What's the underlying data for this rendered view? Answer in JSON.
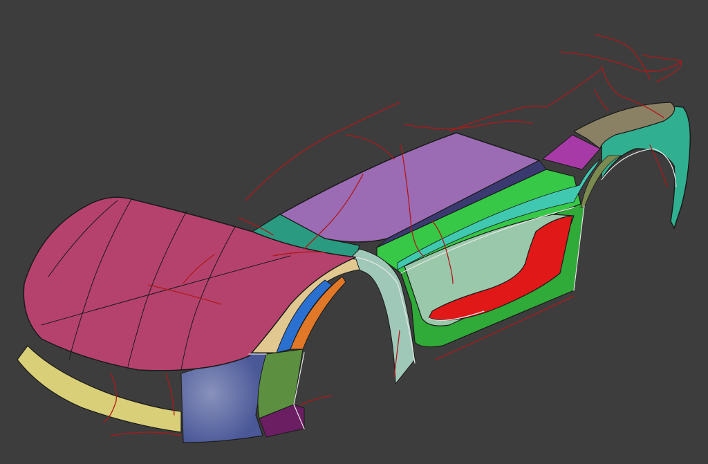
{
  "scene": {
    "background": "#3d3d3d",
    "edge_color": "#1a1a1a",
    "seam_color": "#e8e8e8",
    "curve_color": "#b01818",
    "surfaces": [
      {
        "name": "hood-surface",
        "color": "#b5426d"
      },
      {
        "name": "front-splitter",
        "color": "#d8cf78"
      },
      {
        "name": "front-bumper-corner",
        "color": "#4a5898"
      },
      {
        "name": "fender-inner-green",
        "color": "#5c9040"
      },
      {
        "name": "fender-purple-patch",
        "color": "#6c1e62"
      },
      {
        "name": "windshield-teal",
        "color": "#2a9a80"
      },
      {
        "name": "roof-lavender",
        "color": "#9b6bb3"
      },
      {
        "name": "roof-rail-navy",
        "color": "#3a3a70"
      },
      {
        "name": "side-green",
        "color": "#36c846"
      },
      {
        "name": "door-lower-green",
        "color": "#30aa38"
      },
      {
        "name": "side-intake-red",
        "color": "#e01818"
      },
      {
        "name": "side-panel-sage",
        "color": "#9ac8aa"
      },
      {
        "name": "rear-deck-khaki",
        "color": "#8a8064"
      },
      {
        "name": "rear-magenta",
        "color": "#a83aa8"
      },
      {
        "name": "rear-fender-teal",
        "color": "#30b090"
      },
      {
        "name": "front-arch-tan",
        "color": "#e0c890"
      },
      {
        "name": "front-arch-blue",
        "color": "#2a70d0"
      },
      {
        "name": "front-arch-orange",
        "color": "#e07828"
      }
    ]
  }
}
